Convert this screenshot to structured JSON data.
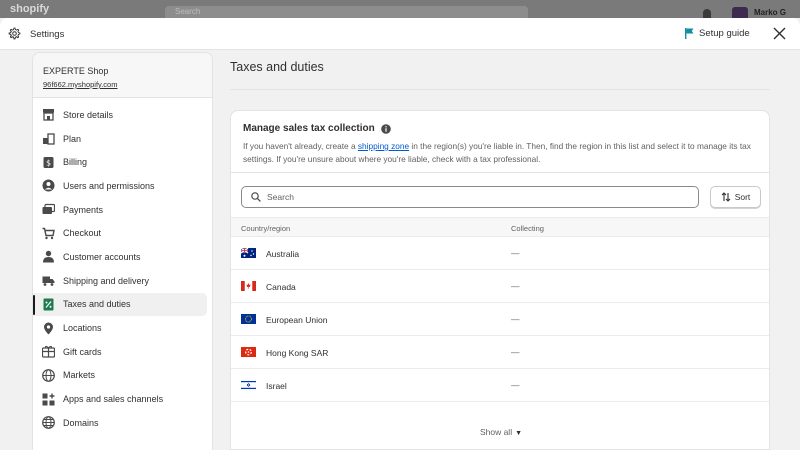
{
  "backdrop": {
    "logo": "shopify",
    "search_placeholder": "Search",
    "user_name": "Marko G"
  },
  "header": {
    "title": "Settings",
    "setup_guide_label": "Setup guide"
  },
  "sidebar": {
    "store_name": "EXPERTE Shop",
    "store_url": "96f662.myshopify.com",
    "items": [
      {
        "label": "Store details",
        "icon": "store-icon"
      },
      {
        "label": "Plan",
        "icon": "plan-icon"
      },
      {
        "label": "Billing",
        "icon": "billing-icon"
      },
      {
        "label": "Users and permissions",
        "icon": "user-icon"
      },
      {
        "label": "Payments",
        "icon": "payments-icon"
      },
      {
        "label": "Checkout",
        "icon": "cart-icon"
      },
      {
        "label": "Customer accounts",
        "icon": "person-icon"
      },
      {
        "label": "Shipping and delivery",
        "icon": "truck-icon"
      },
      {
        "label": "Taxes and duties",
        "icon": "tax-icon",
        "active": true
      },
      {
        "label": "Locations",
        "icon": "location-pin-icon"
      },
      {
        "label": "Gift cards",
        "icon": "gift-icon"
      },
      {
        "label": "Markets",
        "icon": "globe-icon"
      },
      {
        "label": "Apps and sales channels",
        "icon": "apps-icon"
      },
      {
        "label": "Domains",
        "icon": "domain-globe-icon"
      }
    ]
  },
  "main": {
    "title": "Taxes and duties",
    "card": {
      "title": "Manage sales tax collection",
      "desc_before": "If you haven't already, create a ",
      "desc_link": "shipping zone",
      "desc_after": " in the region(s) you're liable in. Then, find the region in this list and select it to manage its tax settings. If you're unsure about where you're liable, check with a tax professional.",
      "search_placeholder": "Search",
      "sort_label": "Sort",
      "columns": [
        "Country/region",
        "Collecting"
      ],
      "rows": [
        {
          "country": "Australia",
          "collecting": "—",
          "flag": "australia-flag"
        },
        {
          "country": "Canada",
          "collecting": "—",
          "flag": "canada-flag"
        },
        {
          "country": "European Union",
          "collecting": "—",
          "flag": "eu-flag"
        },
        {
          "country": "Hong Kong SAR",
          "collecting": "—",
          "flag": "hong-kong-flag"
        },
        {
          "country": "Israel",
          "collecting": "—",
          "flag": "israel-flag"
        }
      ],
      "show_all_label": "Show all"
    }
  },
  "colors": {
    "link": "#005bd3",
    "setup_flag": "#0f8fa3",
    "text": "#303030",
    "muted": "#616161"
  }
}
